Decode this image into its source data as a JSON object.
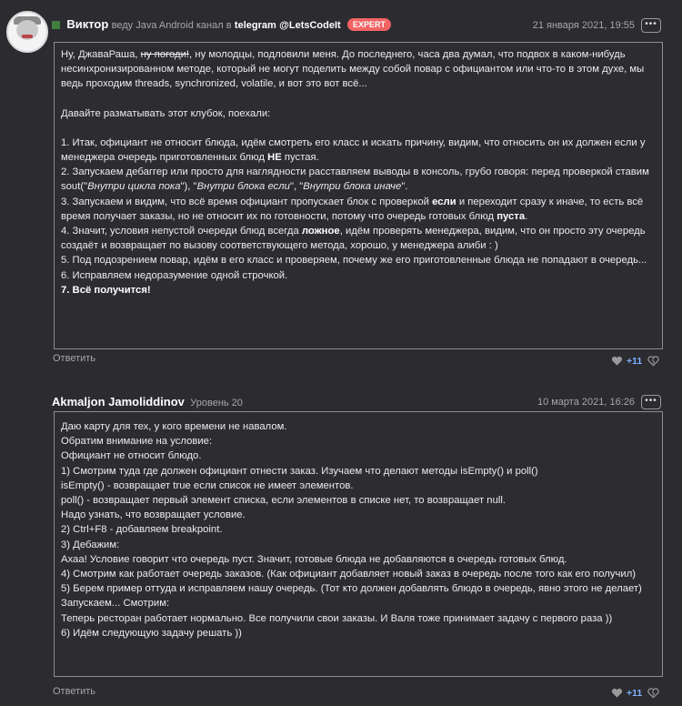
{
  "comment1": {
    "username": "Виктор",
    "subtitle": "веду Java Android канал в",
    "telegram_label": "telegram",
    "telegram_handle": "@LetsCodeIt",
    "badge": "EXPERT",
    "date": "21 января 2021, 19:55",
    "body": {
      "intro_a": "Ну, ДжаваРаша,",
      "intro_strike": "ну погоди!",
      "intro_b": ", ну молодцы, подловили меня. До последнего, часа два думал, что подвох в каком-нибудь несинхронизированном методе, который не могут поделить между собой повар с официантом или что-то в этом духе, мы ведь проходим threads, synchronized, volatile, и вот это вот всё...",
      "line2": "Давайте разматывать этот клубок, поехали:",
      "s1a": "1. Итак, официант не относит блюда, идём смотреть его класс и искать причину, видим, что относить он их должен если у менеджера очередь приготовленных блюд",
      "s1b": "НЕ",
      "s1c": "пустая.",
      "s2a": "2. Запускаем дебаггер или просто для наглядности расставляем выводы в консоль, грубо говоря: перед проверкой ставим sout(\"",
      "s2b": "Внутри цикла пока",
      "s2c": "\"), \"",
      "s2d": "Внутри блока если",
      "s2e": "\", \"",
      "s2f": "Внутри блока иначе",
      "s2g": "\".",
      "s3a": "3. Запускаем и видим, что всё время официант пропускает блок с проверкой",
      "s3b": "если",
      "s3c": "и переходит сразу к иначе, то есть всё время получает заказы, но не относит их по готовности, потому что очередь готовых блюд",
      "s3d": "пуста",
      "s3e": ".",
      "s4a": "4. Значит, условия непустой очереди блюд всегда",
      "s4b": "ложное",
      "s4c": ", идём проверять менеджера, видим, что он просто эту очередь создаёт и возвращает по вызову соответствующего метода, хорошо, у менеджера алиби : )",
      "s5": "5. Под подозрением повар, идём в его класс и проверяем, почему же его приготовленные блюда не попадают в очередь...",
      "s6": "6. Исправляем недоразумение одной строчкой.",
      "s7": "7. Всё получится!"
    },
    "reply_label": "Ответить",
    "likes": "+11"
  },
  "comment2": {
    "username": "Akmaljon Jamoliddinov",
    "level": "Уровень 20",
    "date": "10 марта 2021, 16:26",
    "lines": [
      "Даю карту для тех, у кого времени не навалом.",
      "Обратим внимание  на условие:",
      "Официант не относит блюдо.",
      "1) Смотрим туда где должен официант отнести заказ. Изучаем что делают методы isEmpty() и poll()",
      "isEmpty() - возвращает true если список не имеет элементов.",
      "poll() - возвращает первый элемент списка, если элементов в списке нет, то возвращает null.",
      "Надо узнать, что возвращает условие.",
      "2) Ctrl+F8 - добавляем breakpoint.",
      "3) Дебажим:",
      "Ахаа! Условие говорит что очередь пуст. Значит, готовые блюда не добавляются в очередь готовых блюд.",
      "4) Смотрим как работает очередь заказов. (Как официант добавляет новый заказ в очередь после того как его получил)",
      "5) Берем пример оттуда и исправляем нашу очередь. (Тот кто должен добавлять блюдо в очередь, явно этого не делает) Запускаем... Смотрим:",
      "Теперь ресторан работает нормально. Все получили свои заказы. И Валя тоже принимает задачу с первого раза  ))",
      "6) Идём следующую задачу решать ))"
    ],
    "reply_label": "Ответить",
    "likes": "+11"
  },
  "colors": {
    "likes": "#7fb0ff",
    "badge": "#f26363",
    "background": "#2b2b30",
    "border": "#8e8e8e"
  },
  "icons": {
    "more": "more-icon",
    "heart": "heart-icon",
    "dislike": "broken-heart-icon"
  }
}
